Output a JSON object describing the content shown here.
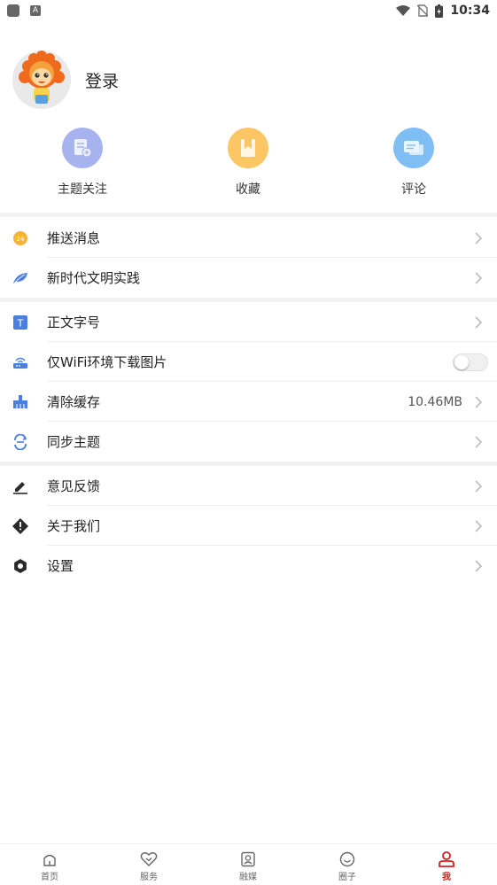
{
  "status_bar": {
    "time": "10:34",
    "icons": [
      "app-square-icon",
      "a-icon",
      "wifi-icon",
      "no-sim-icon",
      "battery-charging-icon"
    ]
  },
  "profile": {
    "login_label": "登录",
    "avatar_icon": "lion-mascot-icon"
  },
  "quick_actions": [
    {
      "label": "主题关注",
      "icon": "document-add-icon",
      "color": "#a7b3ef"
    },
    {
      "label": "收藏",
      "icon": "bookmark-icon",
      "color": "#fcc664"
    },
    {
      "label": "评论",
      "icon": "chat-icon",
      "color": "#7fbdf5"
    }
  ],
  "menu_group1": [
    {
      "label": "推送消息",
      "icon": "push-24-icon"
    },
    {
      "label": "新时代文明实践",
      "icon": "leaf-icon"
    }
  ],
  "menu_group2": [
    {
      "label": "正文字号",
      "icon": "text-size-icon"
    },
    {
      "label": "仅WiFi环境下载图片",
      "icon": "wifi-router-icon",
      "toggle": false
    },
    {
      "label": "清除缓存",
      "icon": "broom-icon",
      "value": "10.46MB"
    },
    {
      "label": "同步主题",
      "icon": "sync-icon"
    }
  ],
  "menu_group3": [
    {
      "label": "意见反馈",
      "icon": "pen-icon"
    },
    {
      "label": "关于我们",
      "icon": "info-diamond-icon"
    },
    {
      "label": "设置",
      "icon": "gear-icon"
    }
  ],
  "tabbar": [
    {
      "label": "首页",
      "icon": "home-icon",
      "active": false
    },
    {
      "label": "服务",
      "icon": "heart-icon",
      "active": false
    },
    {
      "label": "融媒",
      "icon": "media-icon",
      "active": false
    },
    {
      "label": "圈子",
      "icon": "smile-icon",
      "active": false
    },
    {
      "label": "我",
      "icon": "person-icon",
      "active": true
    }
  ],
  "colors": {
    "accent_red": "#d12020",
    "icon_blue": "#4a7fe0"
  }
}
